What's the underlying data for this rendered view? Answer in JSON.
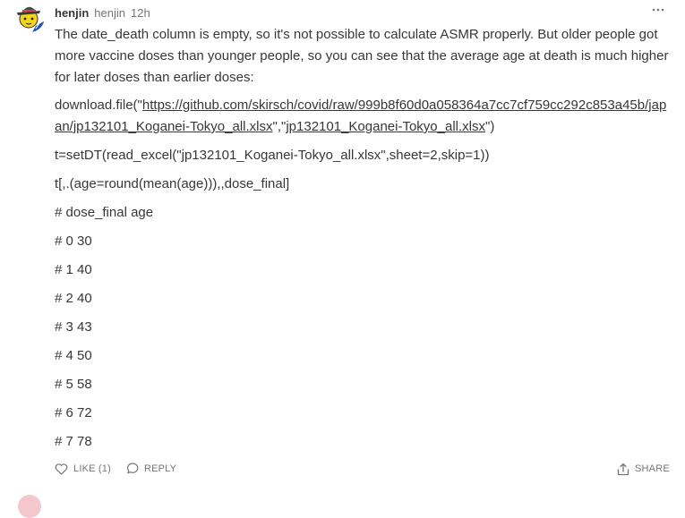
{
  "comment": {
    "author_name": "henjin",
    "author_handle": "henjin",
    "timestamp": "12h",
    "intro": "The date_death column is empty, so it's not possible to calculate ASMR properly. But older people got more vaccine doses than younger people, so you can see that the average age at death is much higher for later doses than earlier doses:",
    "code_download_prefix": "download.file(\"",
    "code_download_url": "https://github.com/skirsch/covid/raw/999b8f60d0a058364a7cc7cf759cc292c853a45b/japan/jp132101_Koganei-Tokyo_all.xlsx",
    "code_download_mid": "\",\"",
    "code_download_file": "jp132101_Koganei-Tokyo_all.xlsx",
    "code_download_suffix": "\")",
    "code_read": "t=setDT(read_excel(\"jp132101_Koganei-Tokyo_all.xlsx\",sheet=2,skip=1))",
    "code_agg": "t[,.(age=round(mean(age))),,dose_final]",
    "result_header": "# dose_final age",
    "result_rows": [
      "# 0 30",
      "# 1 40",
      "# 2 40",
      "# 3 43",
      "# 4 50",
      "# 5 58",
      "# 6 72",
      "# 7 78"
    ]
  },
  "actions": {
    "like_label": "LIKE (1)",
    "reply_label": "REPLY",
    "share_label": "SHARE"
  },
  "icons": {
    "avatar": "avatar-illustration",
    "more": "more-horizontal-icon",
    "like": "heart-icon",
    "reply": "speech-bubble-icon",
    "share": "share-icon"
  }
}
